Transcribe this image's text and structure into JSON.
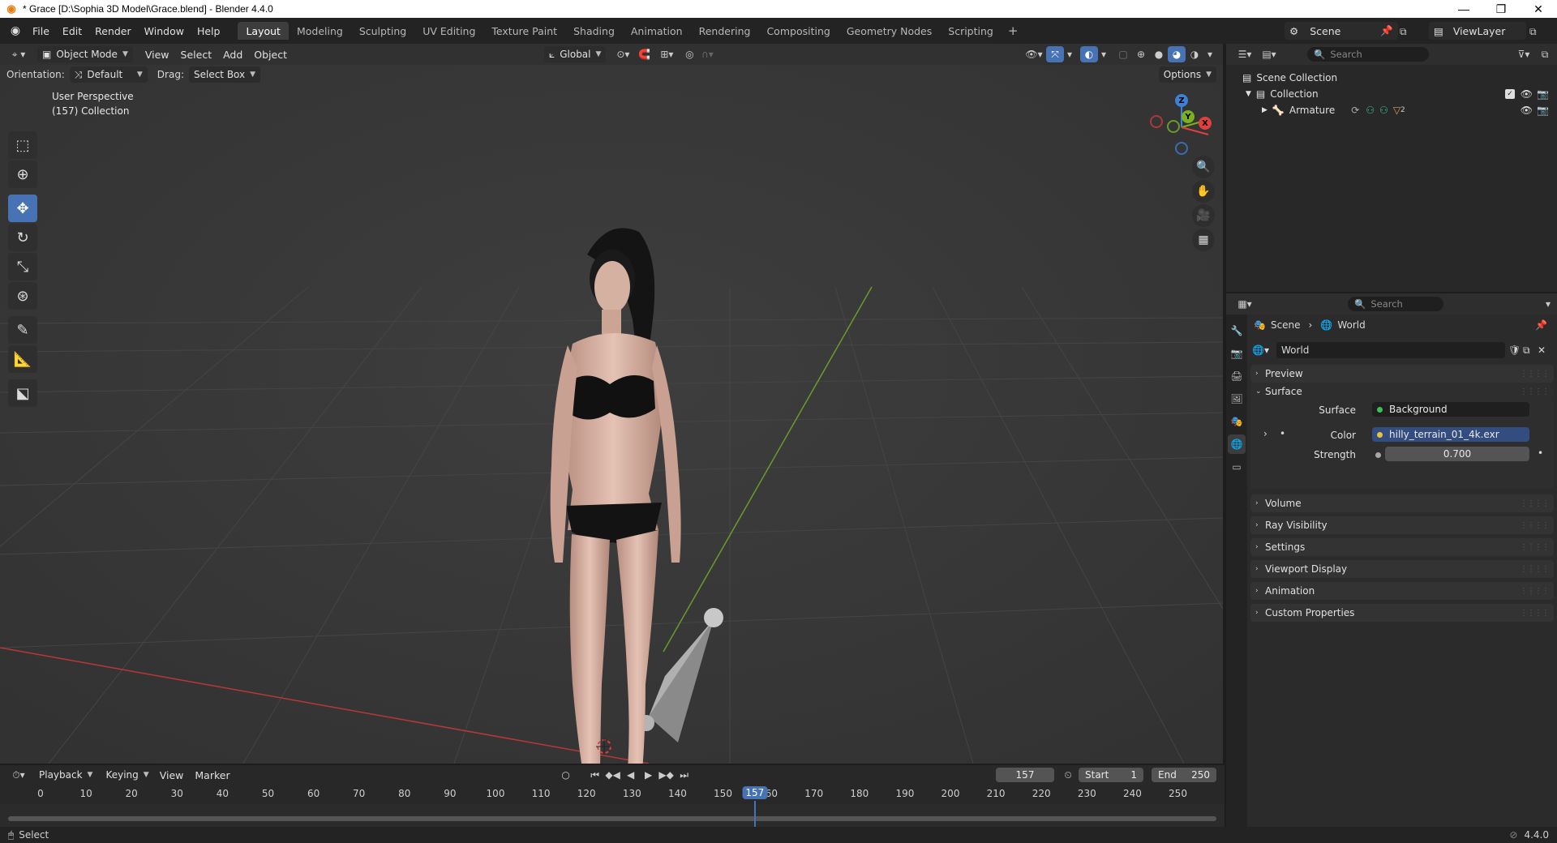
{
  "window": {
    "title": "* Grace [D:\\Sophia 3D Model\\Grace.blend] - Blender 4.4.0"
  },
  "menu": [
    "File",
    "Edit",
    "Render",
    "Window",
    "Help"
  ],
  "workspaces": [
    "Layout",
    "Modeling",
    "Sculpting",
    "UV Editing",
    "Texture Paint",
    "Shading",
    "Animation",
    "Rendering",
    "Compositing",
    "Geometry Nodes",
    "Scripting"
  ],
  "scene": {
    "name": "Scene",
    "view_layer": "ViewLayer"
  },
  "viewport": {
    "mode": "Object Mode",
    "menus": [
      "View",
      "Select",
      "Add",
      "Object"
    ],
    "transform_orientation": "Global",
    "orientation_label": "Orientation:",
    "orientation_value": "Default",
    "drag_label": "Drag:",
    "drag_value": "Select Box",
    "options_label": "Options",
    "info_line1": "User Perspective",
    "info_line2": "(157) Collection",
    "gizmo": {
      "z": "Z",
      "y": "Y",
      "x": "X"
    }
  },
  "timeline": {
    "menus": [
      "Playback",
      "Keying",
      "View",
      "Marker"
    ],
    "current_frame": "157",
    "start_label": "Start",
    "start": "1",
    "end_label": "End",
    "end": "250",
    "ticks": [
      "0",
      "10",
      "20",
      "30",
      "40",
      "50",
      "60",
      "70",
      "80",
      "90",
      "100",
      "110",
      "120",
      "130",
      "140",
      "150",
      "160",
      "170",
      "180",
      "190",
      "200",
      "210",
      "220",
      "230",
      "240",
      "250"
    ],
    "playhead_label": "157"
  },
  "status": {
    "left": "Select",
    "version": "4.4.0"
  },
  "outliner": {
    "search_placeholder": "Search",
    "scene_collection": "Scene Collection",
    "collection": "Collection",
    "armature": "Armature",
    "armature_count": "2"
  },
  "properties": {
    "search_placeholder": "Search",
    "breadcrumb_scene": "Scene",
    "breadcrumb_world": "World",
    "world_name": "World",
    "panels": {
      "preview": "Preview",
      "surface": "Surface",
      "volume": "Volume",
      "ray_visibility": "Ray Visibility",
      "settings": "Settings",
      "viewport_display": "Viewport Display",
      "animation": "Animation",
      "custom_properties": "Custom Properties"
    },
    "surface_label": "Surface",
    "surface_value": "Background",
    "color_label": "Color",
    "color_value": "hilly_terrain_01_4k.exr",
    "strength_label": "Strength",
    "strength_value": "0.700"
  },
  "colors": {
    "accent": "#4772b3",
    "x_axis": "#e2403f",
    "y_axis": "#7bb01f",
    "z_axis": "#3b82d6",
    "bg": "#393939"
  }
}
